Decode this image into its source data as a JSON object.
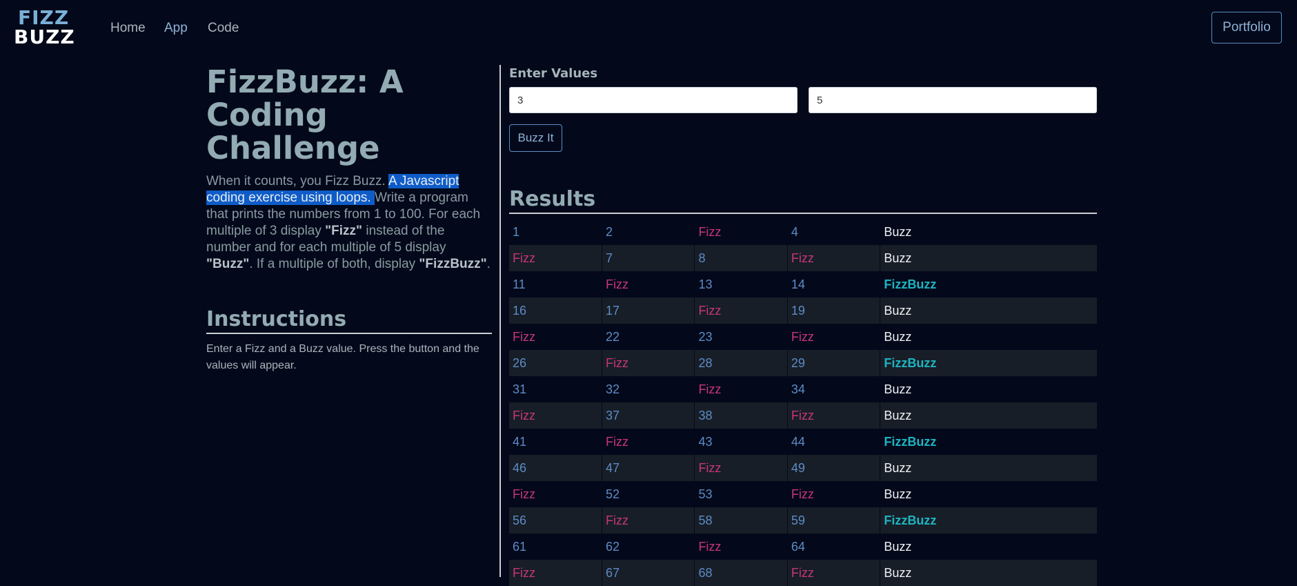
{
  "nav": {
    "logo_line1": "FIZZ",
    "logo_line2": "BUZZ",
    "links": [
      "Home",
      "App",
      "Code"
    ],
    "portfolio_label": "Portfolio"
  },
  "intro": {
    "title": "FizzBuzz: A Coding Challenge",
    "text_before": "When it counts, you Fizz Buzz. ",
    "highlight": "A Javascript coding exercise using loops. ",
    "text_1": "Write a program that prints the numbers from 1 to 100. For each multiple of 3 display ",
    "fizz_quote": "\"Fizz\"",
    "text_2": " instead of the number and for each multiple of 5 display ",
    "buzz_quote": "\"Buzz\"",
    "text_3": ". If a multiple of both, display ",
    "fizzbuzz_quote": "\"FizzBuzz\"",
    "text_4": "."
  },
  "instructions": {
    "title": "Instructions",
    "text": "Enter a Fizz and a Buzz value. Press the button and the values will appear."
  },
  "form": {
    "label": "Enter Values",
    "fizz_value": "3",
    "buzz_value": "5",
    "button_label": "Buzz It"
  },
  "results": {
    "title": "Results",
    "rows": [
      [
        "1",
        "2",
        "Fizz",
        "4",
        "Buzz"
      ],
      [
        "Fizz",
        "7",
        "8",
        "Fizz",
        "Buzz"
      ],
      [
        "11",
        "Fizz",
        "13",
        "14",
        "FizzBuzz"
      ],
      [
        "16",
        "17",
        "Fizz",
        "19",
        "Buzz"
      ],
      [
        "Fizz",
        "22",
        "23",
        "Fizz",
        "Buzz"
      ],
      [
        "26",
        "Fizz",
        "28",
        "29",
        "FizzBuzz"
      ],
      [
        "31",
        "32",
        "Fizz",
        "34",
        "Buzz"
      ],
      [
        "Fizz",
        "37",
        "38",
        "Fizz",
        "Buzz"
      ],
      [
        "41",
        "Fizz",
        "43",
        "44",
        "FizzBuzz"
      ],
      [
        "46",
        "47",
        "Fizz",
        "49",
        "Buzz"
      ],
      [
        "Fizz",
        "52",
        "53",
        "Fizz",
        "Buzz"
      ],
      [
        "56",
        "Fizz",
        "58",
        "59",
        "FizzBuzz"
      ],
      [
        "61",
        "62",
        "Fizz",
        "64",
        "Buzz"
      ],
      [
        "Fizz",
        "67",
        "68",
        "Fizz",
        "Buzz"
      ]
    ]
  },
  "colors": {
    "background": "#03091a",
    "number": "#5e8bc6",
    "fizz": "#c8357a",
    "buzz": "#eef2f5",
    "fizzbuzz": "#1fb3c0",
    "selection_highlight": "#0f5cc8"
  }
}
